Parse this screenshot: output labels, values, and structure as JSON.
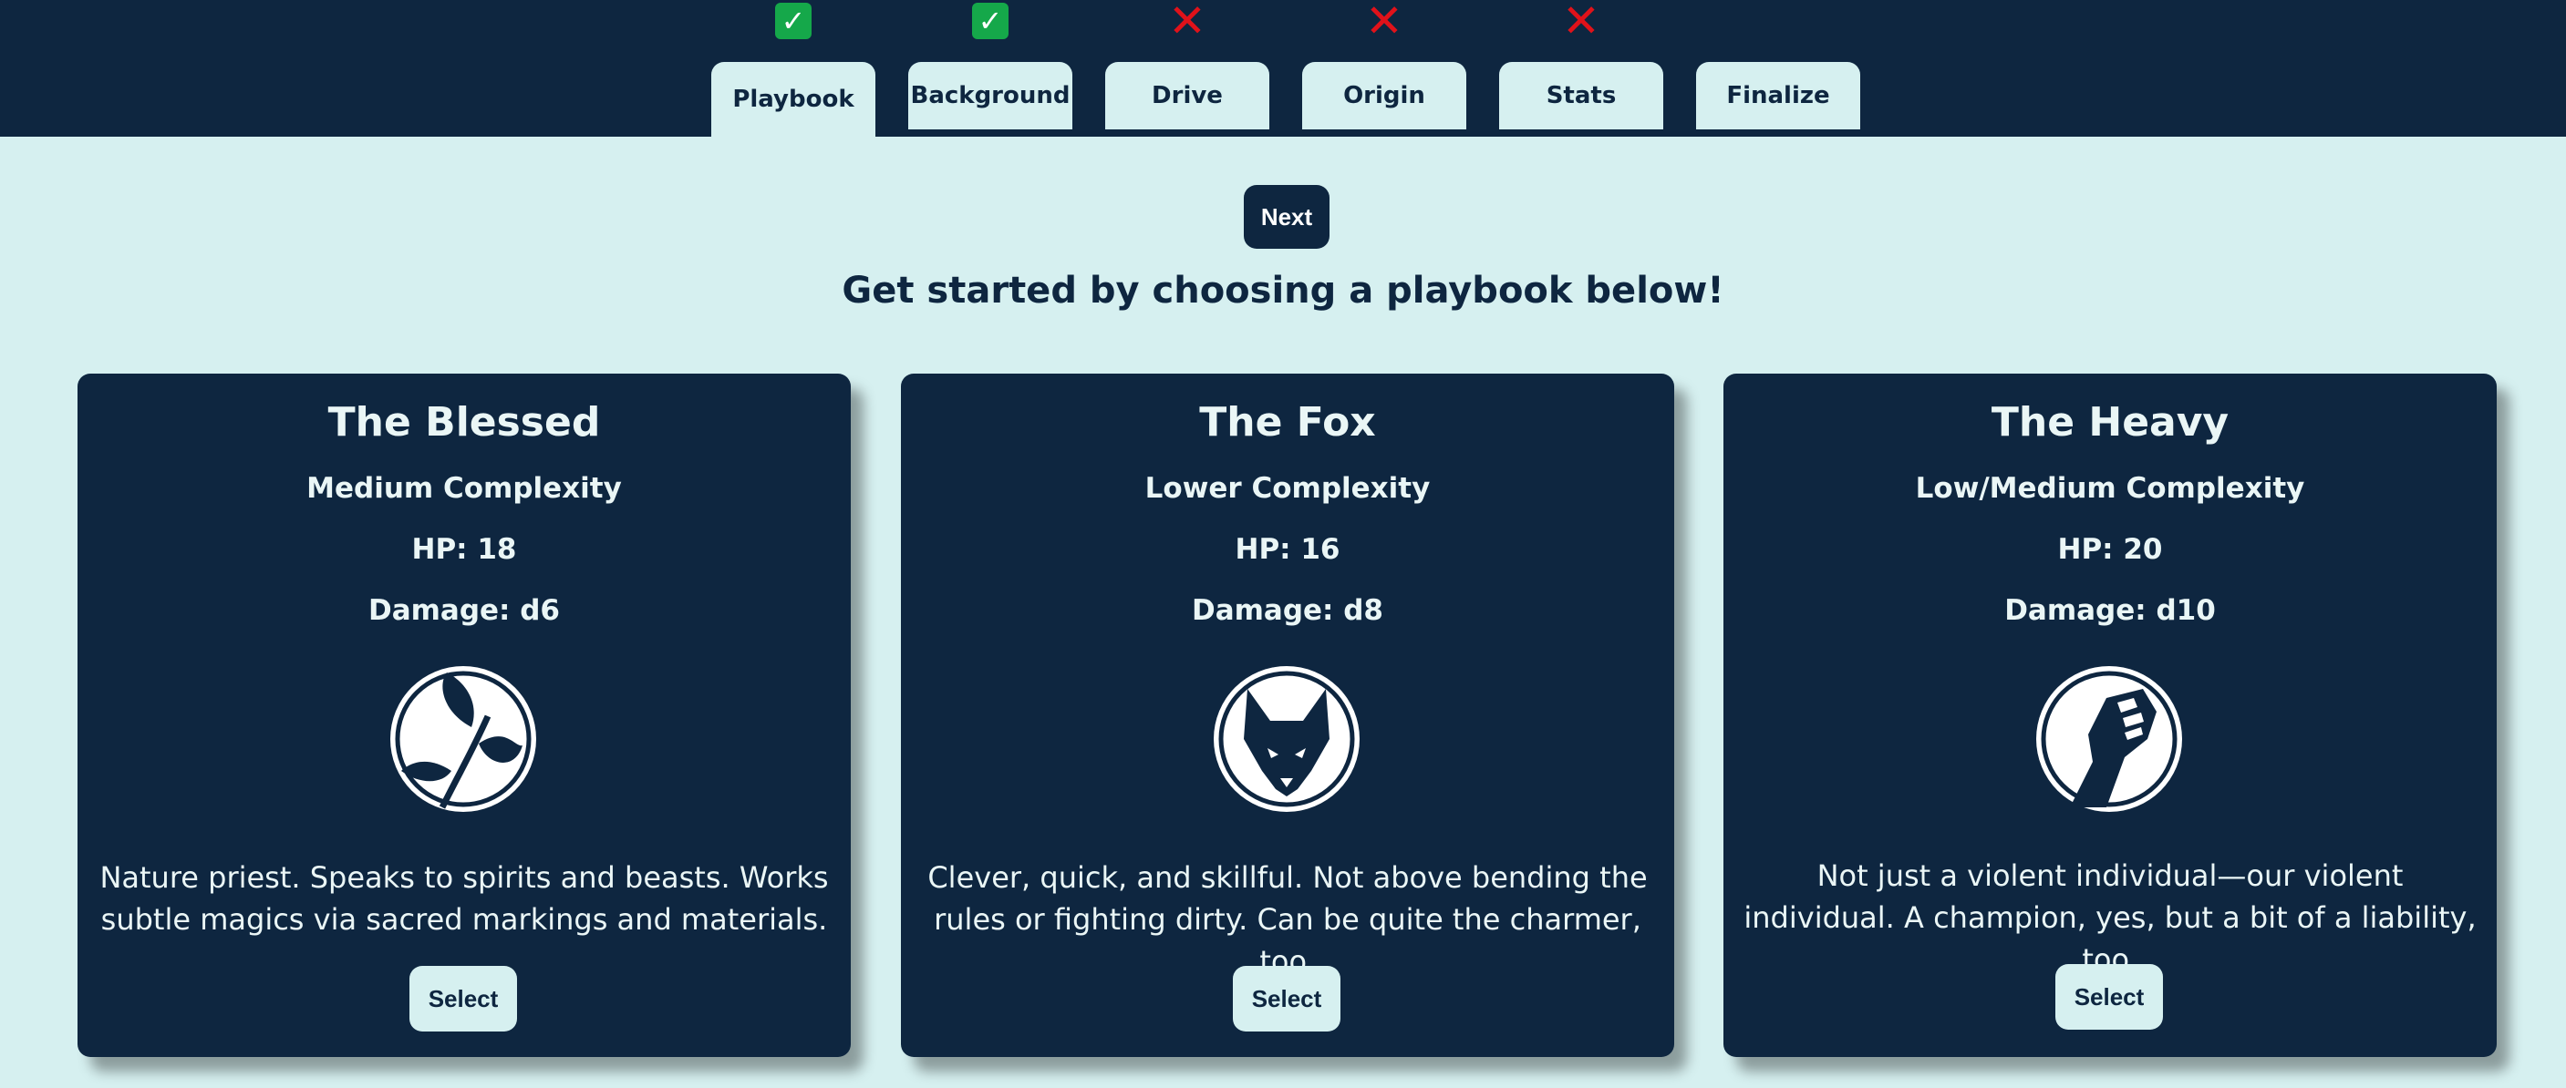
{
  "tabs": [
    {
      "label": "Playbook",
      "status": "done",
      "active": true
    },
    {
      "label": "Background",
      "status": "done",
      "active": false
    },
    {
      "label": "Drive",
      "status": "todo",
      "active": false
    },
    {
      "label": "Origin",
      "status": "todo",
      "active": false
    },
    {
      "label": "Stats",
      "status": "todo",
      "active": false
    },
    {
      "label": "Finalize",
      "status": "todo",
      "active": false
    }
  ],
  "next_label": "Next",
  "headline": "Get started by choosing a playbook below!",
  "cards": [
    {
      "title": "The Blessed",
      "complexity": "Medium Complexity",
      "hp": "HP: 18",
      "damage": "Damage: d6",
      "icon": "leaf-sprout-icon",
      "description": "Nature priest. Speaks to spirits and beasts. Works subtle magics via sacred markings and materials.",
      "select_label": "Select"
    },
    {
      "title": "The Fox",
      "complexity": "Lower Complexity",
      "hp": "HP: 16",
      "damage": "Damage: d8",
      "icon": "fox-head-icon",
      "description": "Clever, quick, and skillful. Not above bending the rules or fighting dirty. Can be quite the charmer, too.",
      "select_label": "Select"
    },
    {
      "title": "The Heavy",
      "complexity": "Low/Medium Complexity",
      "hp": "HP: 20",
      "damage": "Damage: d10",
      "icon": "raised-fist-icon",
      "description": "Not just a violent individual—our violent individual. A champion, yes, but a bit of a liability, too.",
      "select_label": "Select"
    }
  ],
  "colors": {
    "navy": "#0e2640",
    "mint": "#d6f0f0",
    "check_green": "#15a84a",
    "cross_red": "#e0121a"
  }
}
